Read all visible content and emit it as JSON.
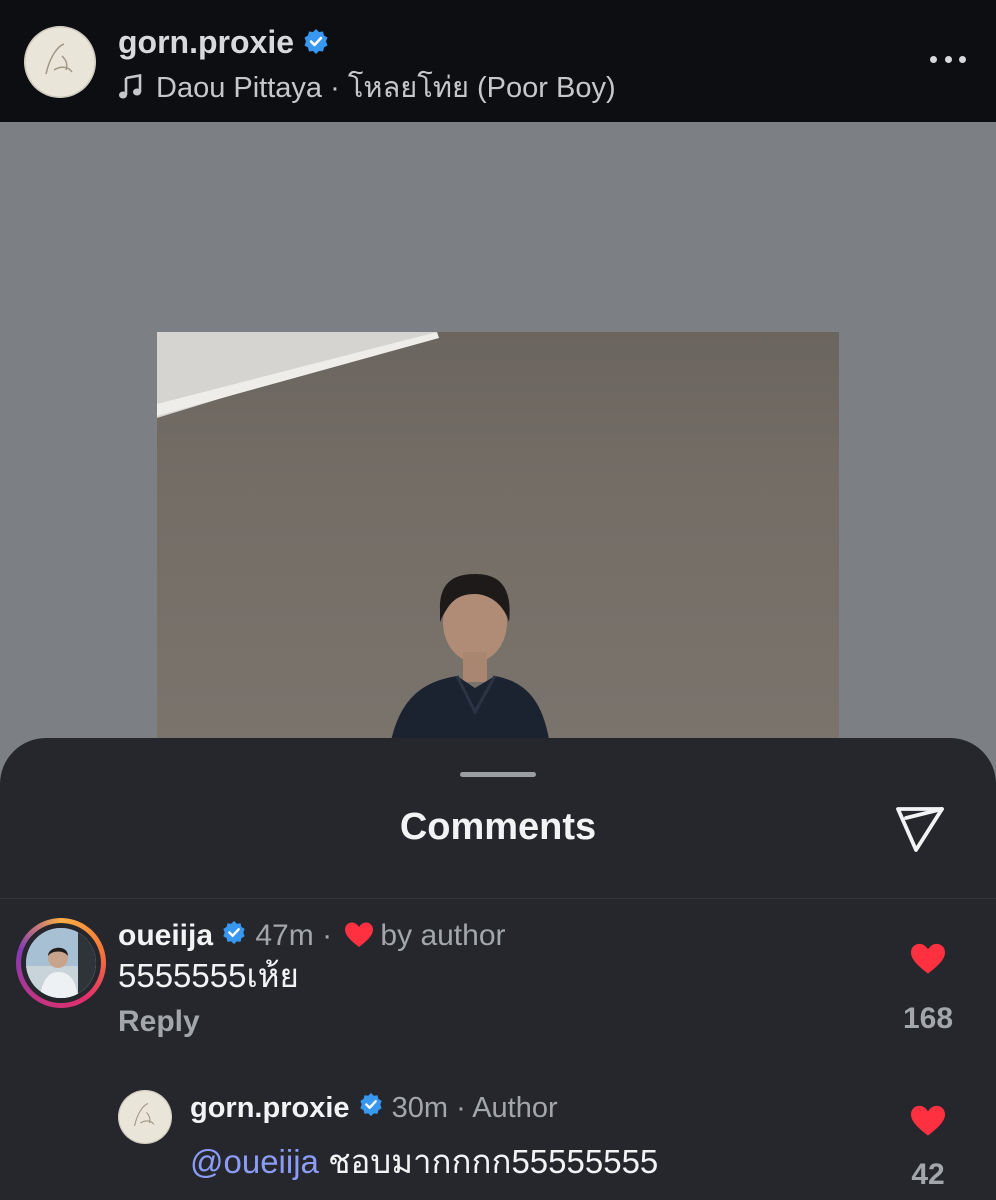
{
  "post_header": {
    "username": "gorn.proxie",
    "verified": true,
    "music": "Daou Pittaya · โหลยโท่ย (Poor Boy)",
    "more_icon": "ellipsis-icon"
  },
  "sheet": {
    "title": "Comments",
    "share_icon": "send-icon"
  },
  "comments": [
    {
      "username": "oueiija",
      "verified": true,
      "time": "47m",
      "liked_by_author": "by author",
      "text": "5555555เห้ย",
      "reply_label": "Reply",
      "likes": "168"
    },
    {
      "username": "gorn.proxie",
      "verified": true,
      "time": "30m",
      "badge": "Author",
      "mention": "@oueiija",
      "text": "ชอบมากกกก55555555",
      "likes": "42"
    }
  ],
  "colors": {
    "header_bg": "#0c0e11",
    "sheet_bg": "#25272c",
    "verified_blue": "#3897f0",
    "heart_red": "#ff3040",
    "mention": "#8b9cf7"
  }
}
